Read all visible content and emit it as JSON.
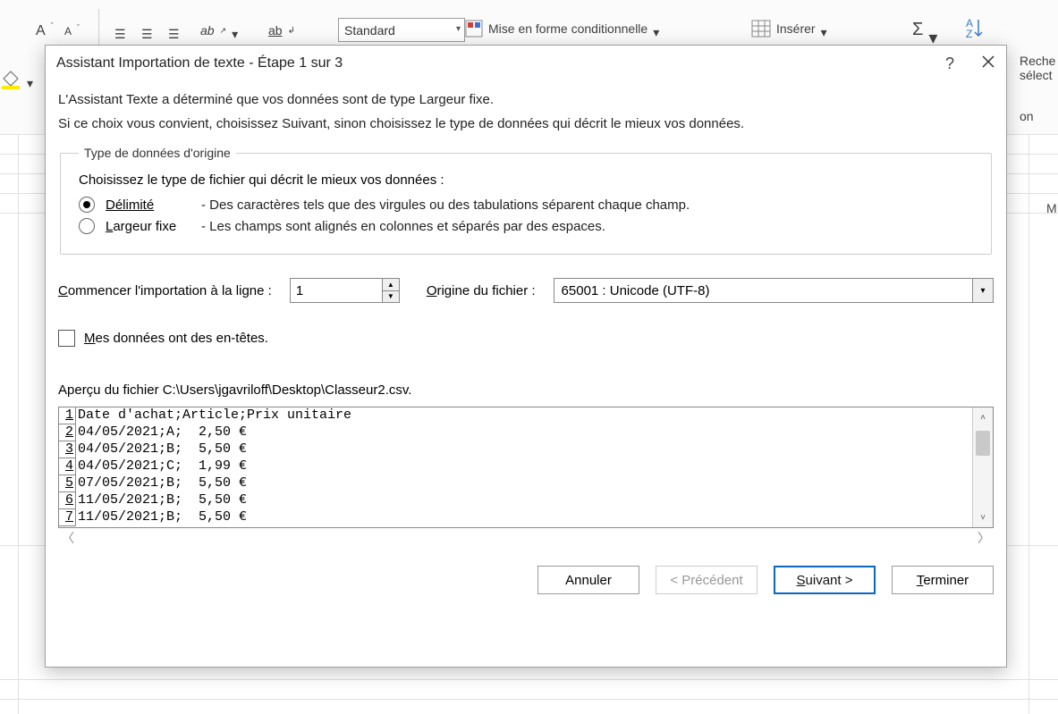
{
  "ribbon": {
    "number_format_value": "Standard",
    "cond_format": "Mise en forme conditionnelle",
    "insert": "Insérer",
    "find_partial1": "Reche",
    "find_partial2": "sélect",
    "on_partial": "on"
  },
  "dialog": {
    "title": "Assistant Importation de texte - Étape 1 sur 3",
    "intro1": "L'Assistant Texte a déterminé que vos données sont de type Largeur fixe.",
    "intro2": "Si ce choix vous convient, choisissez Suivant, sinon choisissez le type de données qui décrit le mieux vos données.",
    "legend": "Type de données d'origine",
    "choose": "Choisissez le type de fichier qui décrit le mieux vos données :",
    "opt_delim_label": "Délimité",
    "opt_delim_desc": "- Des caractères tels que des virgules ou des tabulations séparent chaque champ.",
    "opt_fixed_label_pre": "L",
    "opt_fixed_label_rest": "argeur fixe",
    "opt_fixed_desc": "- Les champs sont alignés en colonnes et séparés par des espaces.",
    "start_row_label_pre": "C",
    "start_row_label_rest": "ommencer l'importation à la ligne :",
    "start_row_value": "1",
    "origin_label_pre": "O",
    "origin_label_rest": "rigine du fichier :",
    "origin_value": "65001 : Unicode (UTF-8)",
    "headers_label_pre": "M",
    "headers_label_rest": "es données ont des en-têtes.",
    "preview_label": "Aperçu du fichier C:\\Users\\jgavriloff\\Desktop\\Classeur2.csv.",
    "preview_rows": [
      {
        "n": "1",
        "t": "Date d'achat;Article;Prix unitaire"
      },
      {
        "n": "2",
        "t": "04/05/2021;A;  2,50 € "
      },
      {
        "n": "3",
        "t": "04/05/2021;B;  5,50 € "
      },
      {
        "n": "4",
        "t": "04/05/2021;C;  1,99 € "
      },
      {
        "n": "5",
        "t": "07/05/2021;B;  5,50 € "
      },
      {
        "n": "6",
        "t": "11/05/2021;B;  5,50 € "
      },
      {
        "n": "7",
        "t": "11/05/2021;B;  5,50 € "
      }
    ],
    "btn_cancel": "Annuler",
    "btn_prev": "< Précédent",
    "btn_next_pre": "S",
    "btn_next_rest": "uivant >",
    "btn_finish_pre": "T",
    "btn_finish_rest": "erminer",
    "help": "?",
    "col_header_M": "M"
  }
}
